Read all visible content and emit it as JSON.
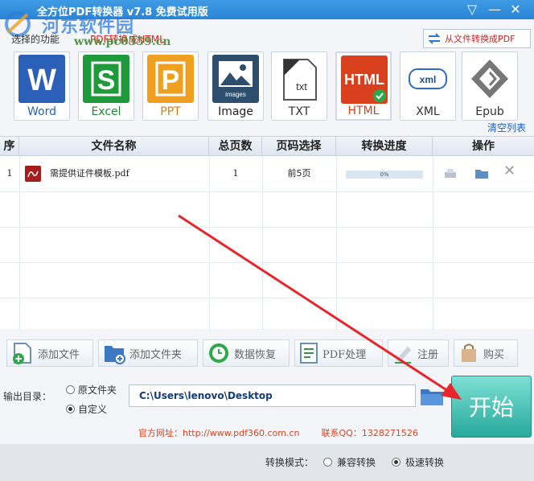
{
  "title": "全方位PDF转换器 v7.8 免费试用版",
  "watermark": {
    "name": "河东软件园",
    "url": "www.pc0359.cn"
  },
  "func_bar": {
    "label": "选择的功能",
    "current": "PDF转换成HTML",
    "reverse_button": "从文件转换成PDF"
  },
  "formats": [
    {
      "label": "Word",
      "icon": "word-icon"
    },
    {
      "label": "Excel",
      "icon": "excel-icon"
    },
    {
      "label": "PPT",
      "icon": "ppt-icon"
    },
    {
      "label": "Image",
      "icon": "image-icon",
      "inner": "images"
    },
    {
      "label": "TXT",
      "icon": "txt-icon",
      "inner": "txt"
    },
    {
      "label": "HTML",
      "icon": "html-icon",
      "inner": "HTML"
    },
    {
      "label": "XML",
      "icon": "xml-icon",
      "inner": "xml"
    },
    {
      "label": "Epub",
      "icon": "epub-icon"
    }
  ],
  "selected_format": "HTML",
  "clear_list": "清空列表",
  "table": {
    "headers": [
      "序",
      "文件名称",
      "总页数",
      "页码选择",
      "转换进度",
      "操作"
    ],
    "rows": [
      {
        "index": "1",
        "name": "需提供证件模板.pdf",
        "pages": "1",
        "range": "前5页",
        "progress_text": "0%",
        "progress": 0
      }
    ]
  },
  "toolbar": {
    "add_file": "添加文件",
    "add_folder": "添加文件夹",
    "recover": "数据恢复",
    "pdf_process": "PDF处理",
    "register": "注册",
    "buy": "购买"
  },
  "output": {
    "label": "输出目录：",
    "option_source": "原文件夹",
    "option_custom": "自定义",
    "selected": "自定义",
    "path": "C:\\Users\\lenovo\\Desktop"
  },
  "start_button": "开始",
  "footer": {
    "website": "官方网址：http://www.pdf360.com.cn",
    "contact": "联系QQ：1328271526",
    "mode_label": "转换模式：",
    "mode_compat": "兼容转换",
    "mode_fast": "极速转换",
    "mode_selected": "极速转换"
  },
  "colors": {
    "title_bar": "#2f8cdc",
    "accent_red": "#d42222",
    "start_button": "#2fb3a4",
    "progress": "#5a9be0"
  }
}
